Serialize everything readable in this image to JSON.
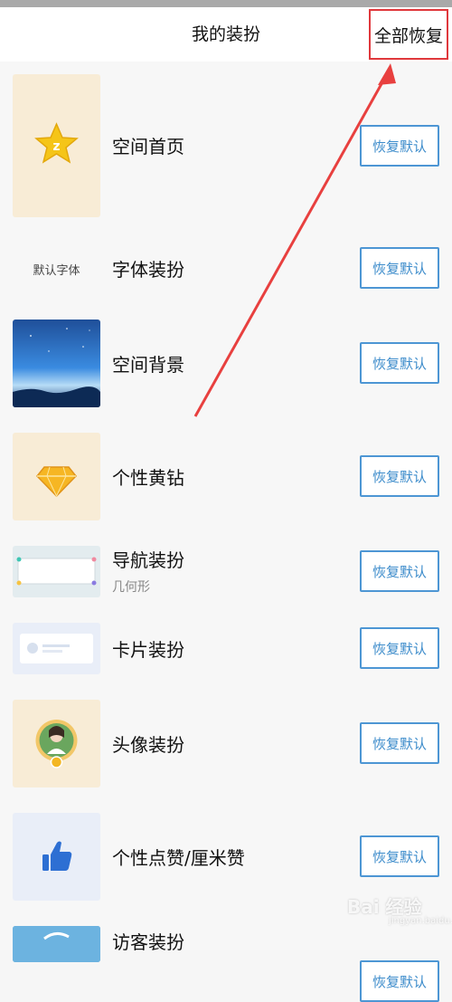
{
  "header": {
    "title": "我的装扮",
    "restore_all": "全部恢复"
  },
  "button_label": "恢复默认",
  "items": [
    {
      "title": "空间首页",
      "thumb": "qzone-star-icon"
    },
    {
      "title": "字体装扮",
      "thumb_text": "默认字体"
    },
    {
      "title": "空间背景",
      "thumb": "night-sky-image"
    },
    {
      "title": "个性黄钻",
      "thumb": "yellow-diamond-icon"
    },
    {
      "title": "导航装扮",
      "subtitle": "几何形",
      "thumb": "nav-frame-image"
    },
    {
      "title": "卡片装扮",
      "thumb": "card-preview-image"
    },
    {
      "title": "头像装扮",
      "thumb": "avatar-frame-image"
    },
    {
      "title": "个性点赞/厘米赞",
      "thumb": "thumbs-up-icon"
    },
    {
      "title": "访客装扮",
      "thumb": "visitor-image"
    }
  ],
  "colors": {
    "accent": "#4d96d4",
    "highlight": "#e0383c"
  },
  "watermark": {
    "text": "Bai 经验",
    "sub": "jingyan.baidu.com"
  }
}
